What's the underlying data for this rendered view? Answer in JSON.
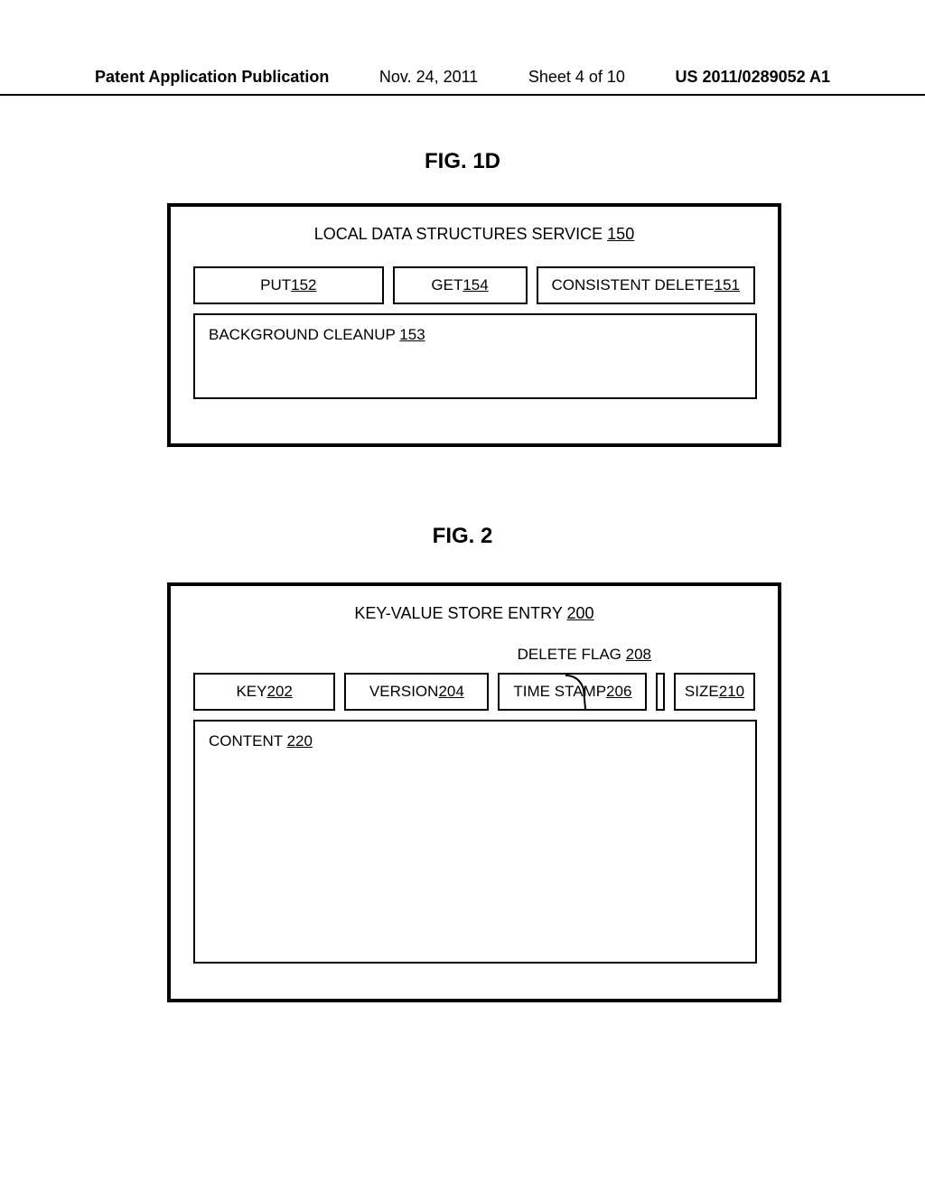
{
  "header": {
    "pub_label": "Patent Application Publication",
    "pub_date": "Nov. 24, 2011",
    "pub_sheet": "Sheet 4 of 10",
    "pub_number": "US 2011/0289052 A1"
  },
  "fig1d": {
    "label": "FIG. 1D",
    "title_prefix": "LOCAL DATA STRUCTURES SERVICE ",
    "title_ref": "150",
    "put_prefix": "PUT ",
    "put_ref": "152",
    "get_prefix": "GET ",
    "get_ref": "154",
    "delete_prefix": "CONSISTENT DELETE ",
    "delete_ref": "151",
    "cleanup_prefix": "BACKGROUND CLEANUP ",
    "cleanup_ref": "153"
  },
  "fig2": {
    "label": "FIG. 2",
    "title_prefix": "KEY-VALUE STORE ENTRY ",
    "title_ref": "200",
    "delete_flag_prefix": "DELETE FLAG ",
    "delete_flag_ref": "208",
    "key_prefix": "KEY",
    "key_ref": "202",
    "version_prefix": "VERSION ",
    "version_ref": "204",
    "timestamp_prefix": "TIME STAMP ",
    "timestamp_ref": "206",
    "size_prefix": "SIZE",
    "size_ref": "210",
    "content_prefix": "CONTENT ",
    "content_ref": "220"
  }
}
